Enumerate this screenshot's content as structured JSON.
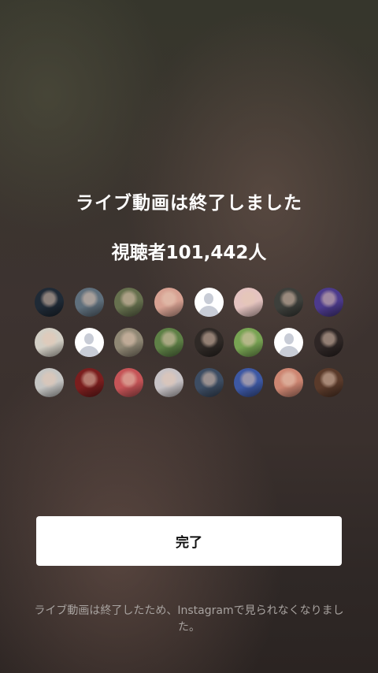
{
  "screen": {
    "title": "ライブ動画は終了しました",
    "viewers_label": "視聴者101,442人",
    "done_button": "完了",
    "footer_note": "ライブ動画は終了したため、Instagramで見られなくなりました。"
  },
  "viewer_avatars": [
    {
      "type": "photo",
      "color": "#1f2a36"
    },
    {
      "type": "photo",
      "color": "#5f6f7c"
    },
    {
      "type": "photo",
      "color": "#66704e"
    },
    {
      "type": "photo",
      "color": "#d7a192"
    },
    {
      "type": "placeholder"
    },
    {
      "type": "photo",
      "color": "#e4c3c0"
    },
    {
      "type": "photo",
      "color": "#3d3f3b"
    },
    {
      "type": "photo",
      "color": "#4c3a8c"
    },
    {
      "type": "photo",
      "color": "#d3cfc5"
    },
    {
      "type": "placeholder"
    },
    {
      "type": "photo",
      "color": "#8f8774"
    },
    {
      "type": "photo",
      "color": "#5e8046"
    },
    {
      "type": "photo",
      "color": "#2f2926"
    },
    {
      "type": "photo",
      "color": "#78a353"
    },
    {
      "type": "placeholder"
    },
    {
      "type": "photo",
      "color": "#2e2625"
    },
    {
      "type": "photo",
      "color": "#c5c5c3"
    },
    {
      "type": "photo",
      "color": "#7a1e1e"
    },
    {
      "type": "photo",
      "color": "#c55457"
    },
    {
      "type": "photo",
      "color": "#c7c2c5"
    },
    {
      "type": "photo",
      "color": "#3d4d63"
    },
    {
      "type": "photo",
      "color": "#3d58a3"
    },
    {
      "type": "photo",
      "color": "#cd8672"
    },
    {
      "type": "photo",
      "color": "#5a3a2a"
    }
  ]
}
